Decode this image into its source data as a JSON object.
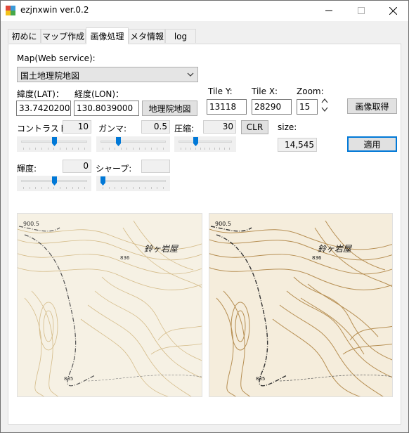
{
  "window": {
    "title": "ezjnxwin ver.0.2"
  },
  "tabs": [
    {
      "label": "初めに"
    },
    {
      "label": "マップ作成"
    },
    {
      "label": "画像処理"
    },
    {
      "label": "メタ情報"
    },
    {
      "label": "log"
    }
  ],
  "map_service": {
    "label": "Map(Web service):",
    "selected": "国土地理院地図"
  },
  "coords": {
    "lat_label": "緯度(LAT)：",
    "lat_value": "33.7420200",
    "lon_label": "経度(LON)：",
    "lon_value": "130.8039000",
    "gsi_button": "地理院地図"
  },
  "tiles": {
    "tiley_label": "Tile Y:",
    "tiley_value": "13118",
    "tilex_label": "Tile X:",
    "tilex_value": "28290",
    "zoom_label": "Zoom:",
    "zoom_value": "15",
    "get_image_button": "画像取得"
  },
  "adjust": {
    "contrast_label": "コントラスト:",
    "contrast_value": "10",
    "contrast_level": 0.5,
    "gamma_label": "ガンマ:",
    "gamma_value": "0.5",
    "gamma_level": 0.25,
    "compress_label": "圧縮:",
    "compress_value": "30",
    "compress_level": 0.3,
    "clr_button": "CLR",
    "size_label": "size:",
    "size_value": "14,545",
    "apply_button": "適用",
    "brightness_label": "輝度:",
    "brightness_value": "0",
    "brightness_level": 0.5,
    "sharp_label": "シャープ:",
    "sharp_value": "",
    "sharp_level": 0.0
  },
  "map_labels": {
    "place_name": "鈴ヶ岩屋",
    "elev1": "836",
    "elev2": "900.5",
    "elev3": "835"
  },
  "colors": {
    "accent": "#0078d7",
    "map_bg": "#f6f1e4",
    "contour": "#c9a96a",
    "road": "#555555"
  }
}
